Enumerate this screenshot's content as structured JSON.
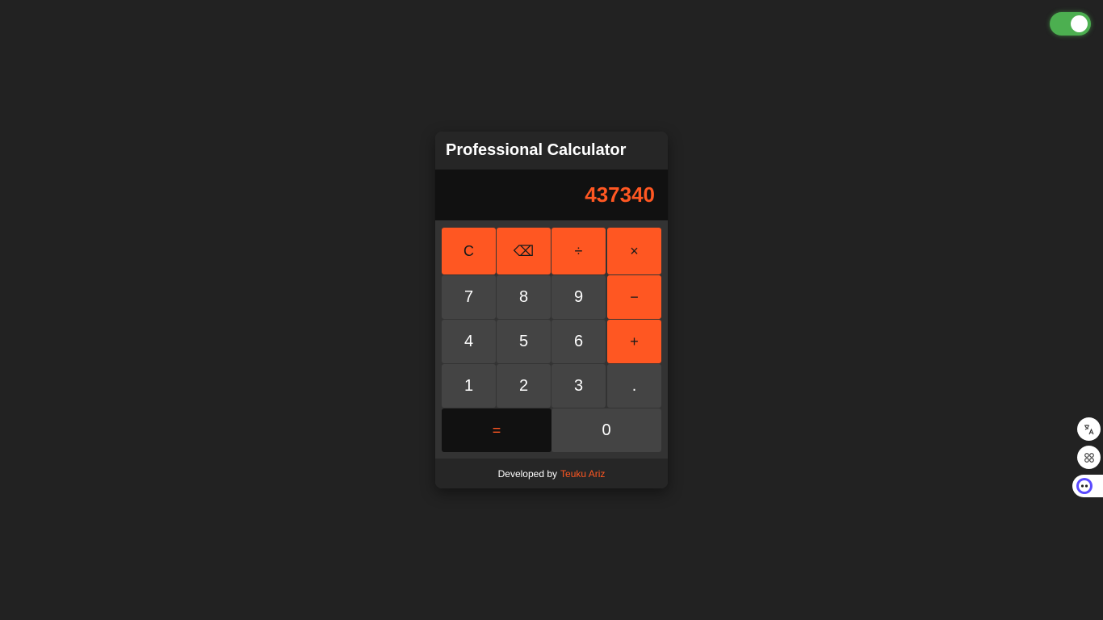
{
  "theme_toggle": {
    "state": "on"
  },
  "calculator": {
    "title": "Professional Calculator",
    "display": "437340",
    "keys": {
      "clear": "C",
      "backspace": "⌫",
      "divide": "÷",
      "multiply": "×",
      "seven": "7",
      "eight": "8",
      "nine": "9",
      "minus": "−",
      "four": "4",
      "five": "5",
      "six": "6",
      "plus": "+",
      "one": "1",
      "two": "2",
      "three": "3",
      "decimal": ".",
      "equals": "=",
      "zero": "0"
    },
    "footer": {
      "prefix": "Developed by",
      "author": "Teuku Ariz"
    }
  },
  "colors": {
    "accent": "#ff5722",
    "background": "#222222",
    "key": "#444444",
    "toggle_on": "#4caf50"
  },
  "side_tools": {
    "icons": [
      "translate-icon",
      "apps-icon",
      "assistant-icon"
    ]
  }
}
